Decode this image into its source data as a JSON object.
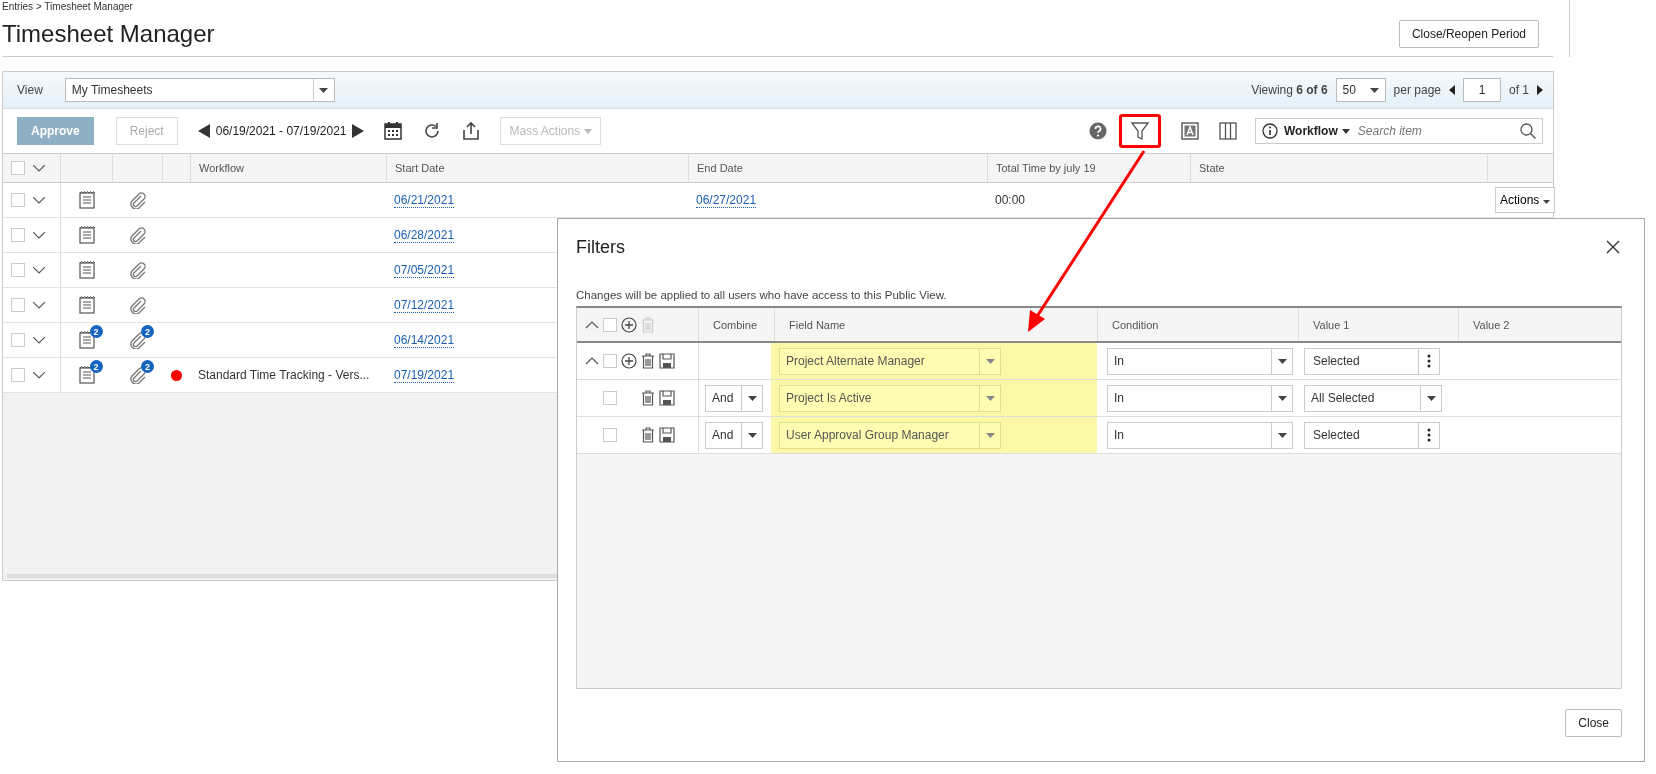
{
  "breadcrumb": "Entries > Timesheet Manager",
  "title": "Timesheet Manager",
  "close_period_button": "Close/Reopen Period",
  "view": {
    "label": "View",
    "value": "My Timesheets"
  },
  "pagination": {
    "viewing": "Viewing **6 of 6**",
    "per_page": "50",
    "per_page_label": "per page",
    "page": "1",
    "of": "of 1"
  },
  "toolbar": {
    "approve": {
      "label": "Approve",
      "disabled": true
    },
    "reject": {
      "label": "Reject",
      "disabled": true
    },
    "date_range": "06/19/2021 - 07/19/2021",
    "mass_actions": {
      "label": "Mass Actions",
      "disabled": true
    },
    "filter_highlighted": true
  },
  "search": {
    "scope": "Workflow",
    "placeholder": "Search item"
  },
  "header_checked": false,
  "columns": [
    "Workflow",
    "Start Date",
    "End Date",
    "Total Time by july 19",
    "State"
  ],
  "rows": [
    {
      "checked": false,
      "start_date": "06/21/2021",
      "end_date": "06/27/2021",
      "total_time": "00:00",
      "actions": "Actions"
    },
    {
      "checked": false,
      "start_date": "06/28/2021"
    },
    {
      "checked": false,
      "start_date": "07/05/2021"
    },
    {
      "checked": false,
      "start_date": "07/12/2021"
    },
    {
      "checked": false,
      "sheet_badge": "2",
      "clip_badge": "2",
      "start_date": "06/14/2021"
    },
    {
      "checked": false,
      "sheet_badge": "2",
      "clip_badge": "2",
      "color": "#ff0000",
      "workflow": "Standard Time Tracking - Vers...",
      "start_date": "07/19/2021"
    }
  ],
  "dialog": {
    "title": "Filters",
    "note": "Changes will be applied to all users who have access to this Public View.",
    "header_checked": false,
    "columns": [
      "Combine",
      "Field Name",
      "Condition",
      "Value 1",
      "Value 2"
    ],
    "filters": [
      {
        "kind": "group",
        "checked": false,
        "field": "Project Alternate Manager",
        "condition": "In",
        "value1": {
          "kind": "menu",
          "label": "Selected"
        }
      },
      {
        "kind": "rule",
        "checked": false,
        "combine": "And",
        "field": "Project Is Active",
        "condition": "In",
        "value1": {
          "kind": "select",
          "label": "All Selected"
        }
      },
      {
        "kind": "rule",
        "checked": false,
        "combine": "And",
        "field": "User Approval Group Manager",
        "condition": "In",
        "value1": {
          "kind": "menu",
          "label": "Selected"
        }
      }
    ],
    "close_button": "Close"
  }
}
